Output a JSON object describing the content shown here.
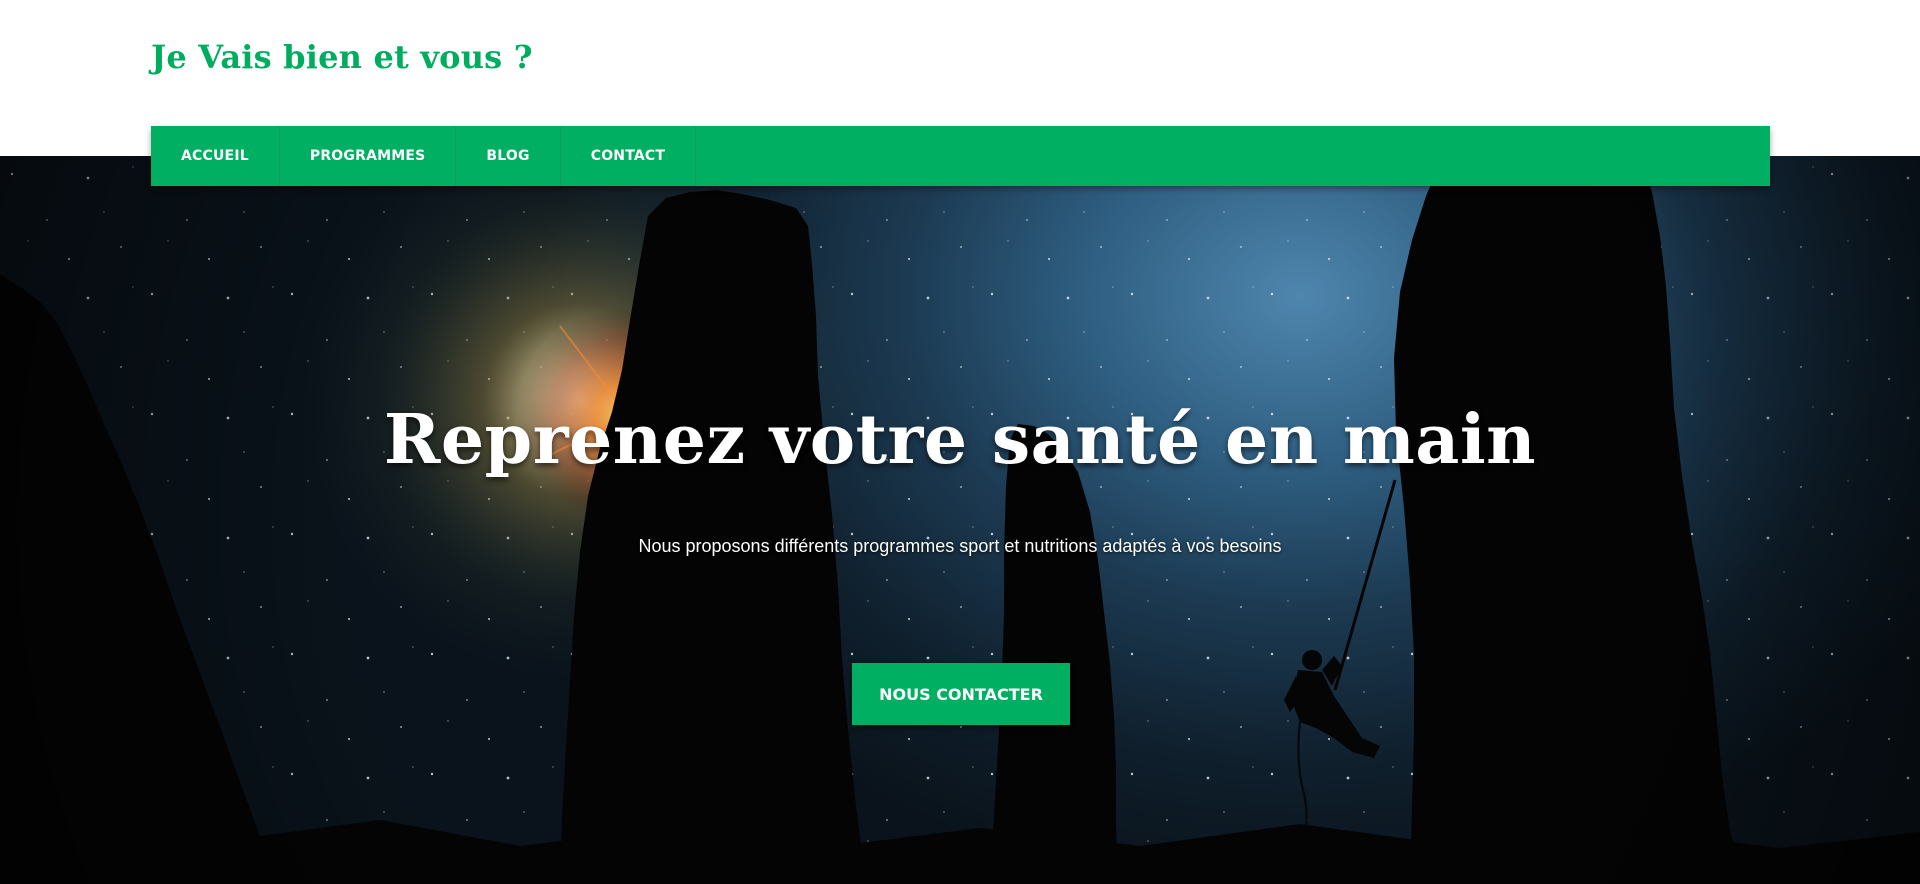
{
  "header": {
    "site_title": "Je Vais bien et vous ?"
  },
  "nav": {
    "items": [
      {
        "label": "ACCUEIL"
      },
      {
        "label": "PROGRAMMES"
      },
      {
        "label": "BLOG"
      },
      {
        "label": "CONTACT"
      }
    ]
  },
  "hero": {
    "title": "Reprenez votre santé en main",
    "subtitle": "Nous proposons différents programmes sport et nutritions adaptés à vos besoins",
    "cta_label": "NOUS CONTACTER",
    "background": "night-sky-rock-climber-photo"
  },
  "colors": {
    "brand_green": "#00af62",
    "title_green": "#00ad5f"
  }
}
